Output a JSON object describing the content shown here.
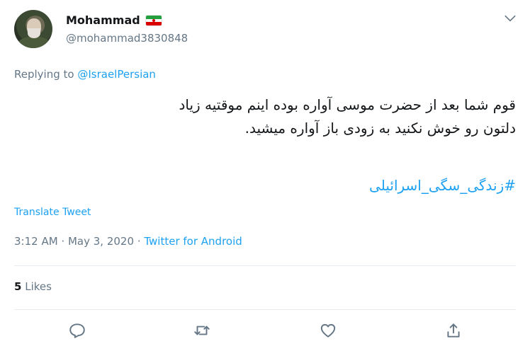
{
  "tweet": {
    "author_name": "Mohammad",
    "flag_icon": "iran-flag-icon",
    "handle": "@mohammad3830848",
    "replying_prefix": "Replying to",
    "replying_to": "@IsraelPersian",
    "text_lines": [
      "قوم شما بعد از حضرت موسی آواره بوده اینم موقتیه زیاد",
      "دلتون رو خوش نکنید به زودی باز آواره میشید."
    ],
    "hashtag": "#زندگی_سگی_اسرائیلی",
    "translate_label": "Translate Tweet",
    "time": "3:12 AM",
    "date": "May 3, 2020",
    "source": "Twitter for Android",
    "likes_count": "5",
    "likes_label": "Likes"
  },
  "actions": {
    "reply_icon": "reply-icon",
    "retweet_icon": "retweet-icon",
    "like_icon": "heart-icon",
    "share_icon": "share-icon"
  },
  "colors": {
    "accent": "#1da1f2",
    "muted": "#657786",
    "text": "#14171a",
    "divider": "#e6ecf0"
  }
}
